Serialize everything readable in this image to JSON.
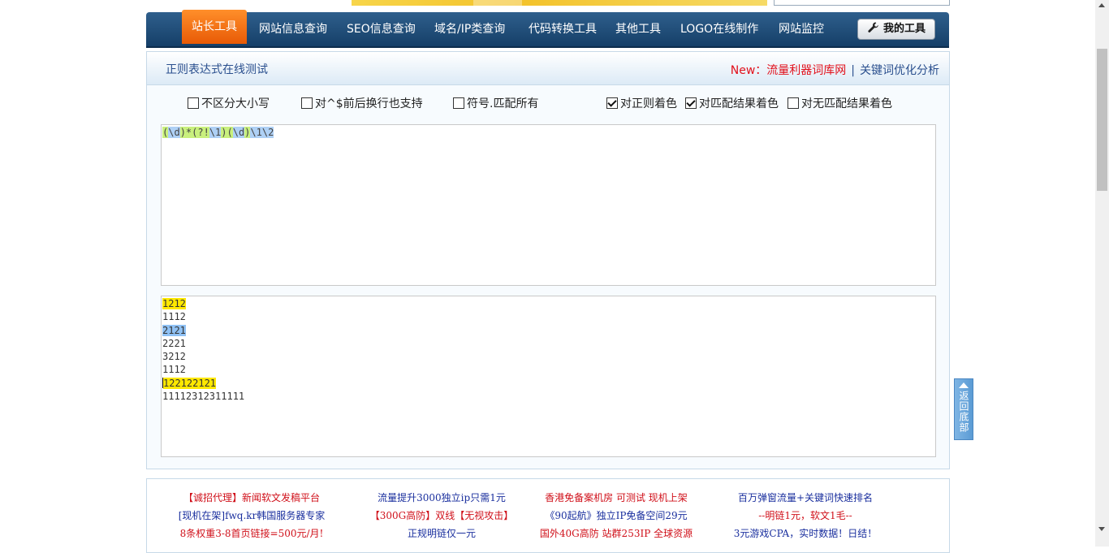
{
  "nav": {
    "items": [
      "站长工具",
      "网站信息查询",
      "SEO信息查询",
      "域名/IP类查询",
      "代码转换工具",
      "其他工具",
      "LOGO在线制作",
      "网站监控"
    ],
    "my_tools": "我的工具"
  },
  "panel": {
    "title": "正则表达式在线测试",
    "new_label": "New：",
    "link1": "流量利器词库网",
    "separator": "|",
    "link2": "关键词优化分析"
  },
  "options": [
    {
      "label": "不区分大小写",
      "checked": false
    },
    {
      "label": "对^$前后换行也支持",
      "checked": false
    },
    {
      "label": "符号.匹配所有",
      "checked": false
    },
    {
      "label": "对正则着色",
      "checked": true
    },
    {
      "label": "对匹配结果着色",
      "checked": true
    },
    {
      "label": "对无匹配结果着色",
      "checked": false
    }
  ],
  "regex": {
    "t1": "(",
    "t2": "\\d",
    "t3": ")*(?!",
    "t4": "\\1",
    "t5": ")(",
    "t6": "\\d",
    "t7": ")",
    "t8": "\\1\\2"
  },
  "test_lines": [
    "1212",
    "1112",
    "2121",
    "2221",
    "3212",
    "1112",
    "122122121",
    "11112312311111"
  ],
  "ads": {
    "col1": [
      "【诚招代理】新闻软文发稿平台",
      "[现机在架]fwq.kr韩国服务器专家",
      "8条权重3-8首页链接=500元/月!"
    ],
    "col2": [
      "流量提升3000独立ip只需1元",
      "【300G高防】双线【无视攻击】",
      "正规明链仅一元"
    ],
    "col3": [
      "香港免备案机房 可测试 现机上架",
      "《90起航》独立IP免备空间29元",
      "国外40G高防 站群253IP 全球资源"
    ],
    "col4": [
      "百万弹窗流量+关键词快速排名",
      "--明链1元，软文1毛--",
      "3元游戏CPA，实时数据！日结！"
    ]
  },
  "back_button": "返回底部",
  "colors": {
    "nav_bg": "#1d4a76",
    "nav_active": "#f26b12",
    "title_blue": "#2a4f8e",
    "link_red": "#e2101b",
    "match_yellow": "#ffe800",
    "match_blue": "#8fc1f4"
  }
}
